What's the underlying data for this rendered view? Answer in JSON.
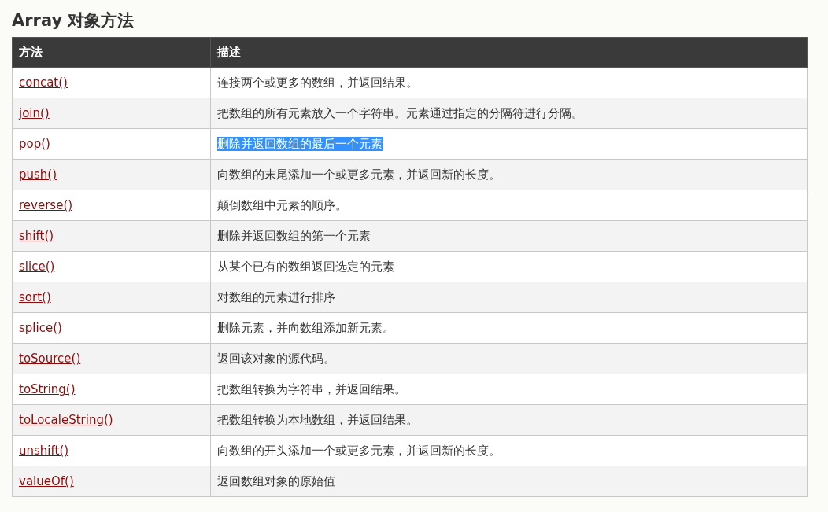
{
  "title": "Array 对象方法",
  "table": {
    "columns": [
      "方法",
      "描述"
    ],
    "rows": [
      {
        "method": "concat()",
        "description": "连接两个或更多的数组，并返回结果。",
        "highlighted": false
      },
      {
        "method": "join()",
        "description": "把数组的所有元素放入一个字符串。元素通过指定的分隔符进行分隔。",
        "highlighted": false
      },
      {
        "method": "pop()",
        "description": "删除并返回数组的最后一个元素",
        "highlighted": true
      },
      {
        "method": "push()",
        "description": "向数组的末尾添加一个或更多元素，并返回新的长度。",
        "highlighted": false
      },
      {
        "method": "reverse()",
        "description": "颠倒数组中元素的顺序。",
        "highlighted": false
      },
      {
        "method": "shift()",
        "description": "删除并返回数组的第一个元素",
        "highlighted": false
      },
      {
        "method": "slice()",
        "description": "从某个已有的数组返回选定的元素",
        "highlighted": false
      },
      {
        "method": "sort()",
        "description": "对数组的元素进行排序",
        "highlighted": false
      },
      {
        "method": "splice()",
        "description": "删除元素，并向数组添加新元素。",
        "highlighted": false
      },
      {
        "method": "toSource()",
        "description": "返回该对象的源代码。",
        "highlighted": false
      },
      {
        "method": "toString()",
        "description": "把数组转换为字符串，并返回结果。",
        "highlighted": false
      },
      {
        "method": "toLocaleString()",
        "description": "把数组转换为本地数组，并返回结果。",
        "highlighted": false
      },
      {
        "method": "unshift()",
        "description": "向数组的开头添加一个或更多元素，并返回新的长度。",
        "highlighted": false
      },
      {
        "method": "valueOf()",
        "description": "返回数组对象的原始值",
        "highlighted": false
      }
    ]
  }
}
